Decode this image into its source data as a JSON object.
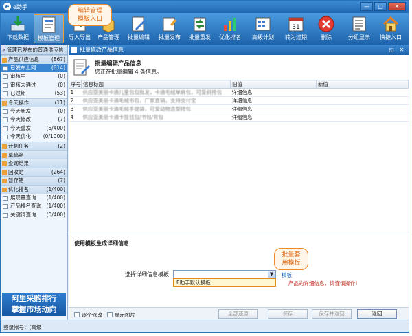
{
  "window": {
    "title": "e助手",
    "min": "—",
    "max": "□",
    "close": "✕"
  },
  "toolbar": {
    "items": [
      {
        "label": "下载数据",
        "icon": "download-icon"
      },
      {
        "label": "模板管理",
        "icon": "template-icon"
      },
      {
        "label": "导入导出",
        "icon": "import-export-icon"
      },
      {
        "label": "产品管理",
        "icon": "product-icon"
      },
      {
        "label": "批量编辑",
        "icon": "batch-edit-icon"
      },
      {
        "label": "批量发布",
        "icon": "batch-publish-icon"
      },
      {
        "label": "批量重发",
        "icon": "batch-republish-icon"
      },
      {
        "label": "优化排名",
        "icon": "rank-icon"
      },
      {
        "label": "高级计划",
        "icon": "plan-icon"
      },
      {
        "label": "转为过期",
        "icon": "calendar-icon"
      },
      {
        "label": "删除",
        "icon": "delete-icon"
      },
      {
        "label": "分组显示",
        "icon": "group-icon"
      },
      {
        "label": "快捷入口",
        "icon": "home-icon"
      }
    ],
    "calendar_day": "31"
  },
  "callouts": {
    "template": "编辑管理\n模板入口",
    "batch": "批量套\n用模板"
  },
  "sidebar": {
    "header": "管理已发布的普通供应信",
    "rows": [
      {
        "label": "产品供应信息",
        "count": "(867)",
        "group": true
      },
      {
        "label": "已发布上网",
        "count": "(814)",
        "selected": true
      },
      {
        "label": "审核中",
        "count": "(0)"
      },
      {
        "label": "审核未通过",
        "count": "(0)"
      },
      {
        "label": "已过期",
        "count": "(53)"
      },
      {
        "label": "今天操作",
        "count": "(11)",
        "group": true
      },
      {
        "label": "今天新发",
        "count": "(0)"
      },
      {
        "label": "今天修改",
        "count": "(7)"
      },
      {
        "label": "今天重发",
        "count": "(5/400)"
      },
      {
        "label": "今天优化",
        "count": "(0/1000)"
      },
      {
        "label": "计划任务",
        "count": "(2)",
        "group": true
      },
      {
        "label": "草稿箱",
        "count": "",
        "group": true
      },
      {
        "label": "查询结果",
        "count": "",
        "group": true
      },
      {
        "label": "回收站",
        "count": "(264)",
        "group": true
      },
      {
        "label": "暂存箱",
        "count": "(7)",
        "group": true
      },
      {
        "label": "优化排名",
        "count": "(1/400)",
        "group": true
      },
      {
        "label": "展现量查询",
        "count": "(1/400)"
      },
      {
        "label": "产品排名查询",
        "count": "(1/400)"
      },
      {
        "label": "关键词查询",
        "count": "(0/400)"
      }
    ],
    "banner_line1": "阿里采购排行",
    "banner_line2": "掌握市场动向"
  },
  "status": {
    "account": "登录帐号：(高级"
  },
  "panel": {
    "title": "批量修改产品信息",
    "heading": "批量编辑产品信息",
    "subtitle": "您正在批量编辑 4 条信息。",
    "table": {
      "headers": [
        "序号",
        "信息标题",
        "旧值",
        "新值"
      ],
      "rows": [
        [
          "1",
          "供应亚美丽卡通儿童包包批发，卡通毛绒单肩包，可爱斜挎包",
          "详细信息",
          ""
        ],
        [
          "2",
          "供应亚美丽卡通毛绒书包，厂家直销，支持支付宝",
          "详细信息",
          ""
        ],
        [
          "3",
          "供应亚美丽卡通毛绒手提袋，可爱动物造型挎包",
          "详细信息",
          ""
        ],
        [
          "4",
          "供应亚美丽卡通卡挂钱包/书包/背包",
          "详细信息",
          ""
        ]
      ]
    },
    "generate": {
      "heading": "使用模板生成详细信息",
      "template_label": "选择详细信息模板:",
      "template_value": "",
      "template_option": "E助手默认模板",
      "link": "模板",
      "warning": "产品的详细信息，请谨慎操作!"
    },
    "bottom": {
      "check1": "逐个修改",
      "check2": "显示图片",
      "btn_reset": "全部还原",
      "btn_save": "保存",
      "btn_save_back": "保存并返回",
      "btn_back": "返回"
    }
  }
}
